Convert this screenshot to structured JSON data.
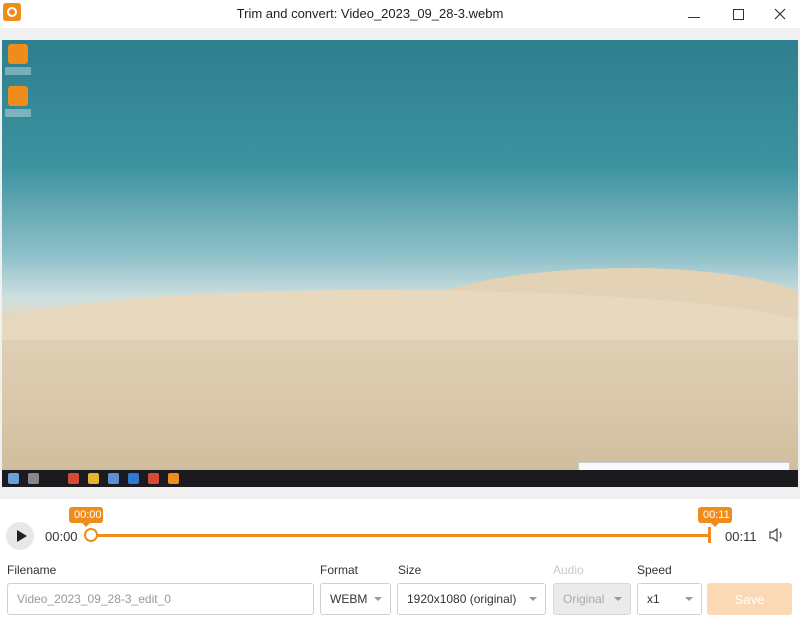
{
  "window": {
    "title": "Trim and convert: Video_2023_09_28-3.webm"
  },
  "player": {
    "current_time": "00:00",
    "end_time": "00:11",
    "trim_start_badge": "00:00",
    "trim_end_badge": "00:11"
  },
  "form": {
    "filename_label": "Filename",
    "filename_value": "Video_2023_09_28-3_edit_0",
    "format_label": "Format",
    "format_value": "WEBM",
    "size_label": "Size",
    "size_value": "1920x1080 (original)",
    "audio_label": "Audio",
    "audio_value": "Original",
    "speed_label": "Speed",
    "speed_value": "x1",
    "save_label": "Save"
  },
  "colors": {
    "accent": "#f08c1c",
    "save_disabled": "#fbd9b4"
  }
}
